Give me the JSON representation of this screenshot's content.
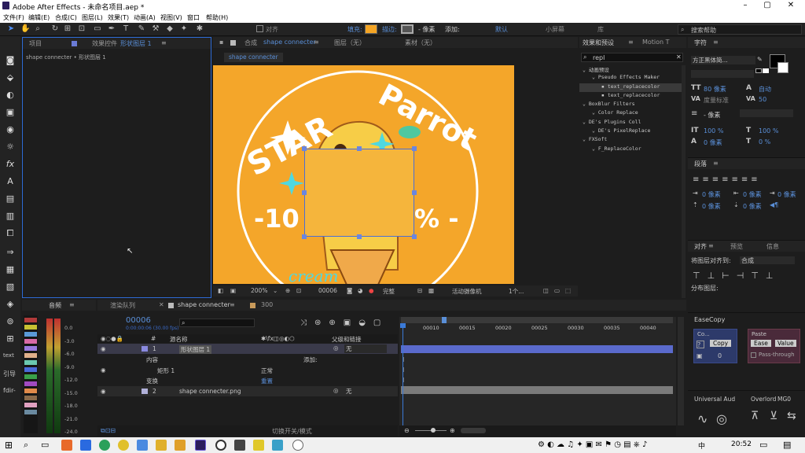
{
  "window": {
    "title": "Adobe After Effects - 未命名项目.aep *"
  },
  "menu": [
    "文件(F)",
    "编辑(E)",
    "合成(C)",
    "图层(L)",
    "效果(T)",
    "动画(A)",
    "视图(V)",
    "窗口",
    "帮助(H)"
  ],
  "toolbar": {
    "snap_label": "对齐",
    "fill_label": "填充:",
    "stroke_label": "描边:",
    "stroke_px": "- 像素",
    "add_label": "添加:",
    "default_label": "默认",
    "learn_label": "了解",
    "small_label": "小屏幕",
    "libraries_label": "库",
    "search_placeholder": "搜索帮助",
    "ws_label": "标准"
  },
  "colors": {
    "fill": "#f5a524",
    "accent": "#2d6bd6",
    "canvas": "#f4a62a",
    "shape": "#f5b53c"
  },
  "project_panel": {
    "tab1": "项目",
    "tab2_prefix": "效果控件",
    "tab2_layer": "形状图层 1",
    "breadcrumb": "shape connecter • 形状图层 1"
  },
  "comp_panel": {
    "tab_prefix": "合成",
    "tab_name": "shape connecter",
    "layer_tab": "图层（无）",
    "footage_tab": "素材（无）",
    "subtab": "shape connecter",
    "artwork_top": "STAR",
    "artwork_right": "Parrot",
    "artwork_mid_left": "-10",
    "artwork_mid_right": "% -",
    "artwork_bottom": "cream",
    "zoom": "200%",
    "timecode": "00006",
    "quality": "完整",
    "camera": "活动摄像机",
    "views": "1个..."
  },
  "effects_panel": {
    "title": "效果和预设",
    "title2": "Motion T",
    "search": "repl",
    "tree": [
      {
        "label": "动画预设",
        "indent": 0
      },
      {
        "label": "Pseudo Effects Maker",
        "indent": 1
      },
      {
        "label": "text_replacecolor",
        "indent": 2,
        "selected": true
      },
      {
        "label": "text_replacecolor",
        "indent": 2
      },
      {
        "label": "BoxBlur Filters",
        "indent": 0
      },
      {
        "label": "Color Replace",
        "indent": 1
      },
      {
        "label": "DE's Plugins Coll",
        "indent": 0
      },
      {
        "label": "DE's PixelReplace",
        "indent": 1
      },
      {
        "label": "FXSoft",
        "indent": 0
      },
      {
        "label": "F_ReplaceColor",
        "indent": 1
      }
    ]
  },
  "character_panel": {
    "title": "字符",
    "font": "方正黑体简...",
    "size": "80 像素",
    "leading": "自动",
    "tracking": "50",
    "kerning": "度量标准",
    "stroke_unit": "- 像素",
    "vscale": "100 %",
    "hscale": "100 %",
    "baseline": "0 像素",
    "tsume": "0 %"
  },
  "paragraph_panel": {
    "title": "段落",
    "indent_left": "0 像素",
    "indent_right": "0 像素",
    "space_before": "0 像素",
    "space_after": "0 像素",
    "first_line": "0 像素"
  },
  "align_panel": {
    "tab1": "对齐",
    "tab2": "预览",
    "tab3": "信息",
    "align_to_label": "将图层对齐到:",
    "align_to_value": "合成",
    "distribute": "分布图层:"
  },
  "easecopy": {
    "title": "EaseCopy",
    "co": "Co...",
    "copy": "Copy",
    "paste": "Paste",
    "ease": "Ease",
    "value": "Value",
    "passthrough": "Pass-through",
    "num": "0"
  },
  "bottom_right": {
    "universal": "Universal Aud",
    "overlord": "Overlord",
    "mgo": "MG0"
  },
  "audio_panel": {
    "title": "音频",
    "scale": [
      "0.0",
      "-3.0",
      "-6.0",
      "-9.0",
      "-12.0",
      "-15.0",
      "-18.0",
      "-21.0",
      "-24.0"
    ],
    "left_labels": [
      "text",
      "引导",
      "fdir-"
    ]
  },
  "timeline": {
    "tab_render": "渲染队列",
    "tab_comp": "shape connecter",
    "tab_other": "300",
    "timecode": "00006",
    "timecode_sub": "0:00:00:06 (30.00 fps)",
    "col_num": "#",
    "col_name": "源名称",
    "col_parent": "父级和链接",
    "ruler": [
      "00010",
      "00015",
      "00020",
      "00025",
      "00030",
      "00035",
      "00040"
    ],
    "rows": [
      {
        "num": "1",
        "name": "形状图层 1",
        "parent": "无",
        "selected": true
      },
      {
        "num": "",
        "name": "内容",
        "extra": "添加:"
      },
      {
        "num": "",
        "name": "矩形 1",
        "extra": "正常"
      },
      {
        "num": "",
        "name": "变换",
        "extra": "重置"
      },
      {
        "num": "2",
        "name": "shape connecter.png",
        "parent": "无"
      }
    ],
    "footer": "切换开关/模式"
  },
  "taskbar": {
    "time": "20:52",
    "ime": "中"
  }
}
